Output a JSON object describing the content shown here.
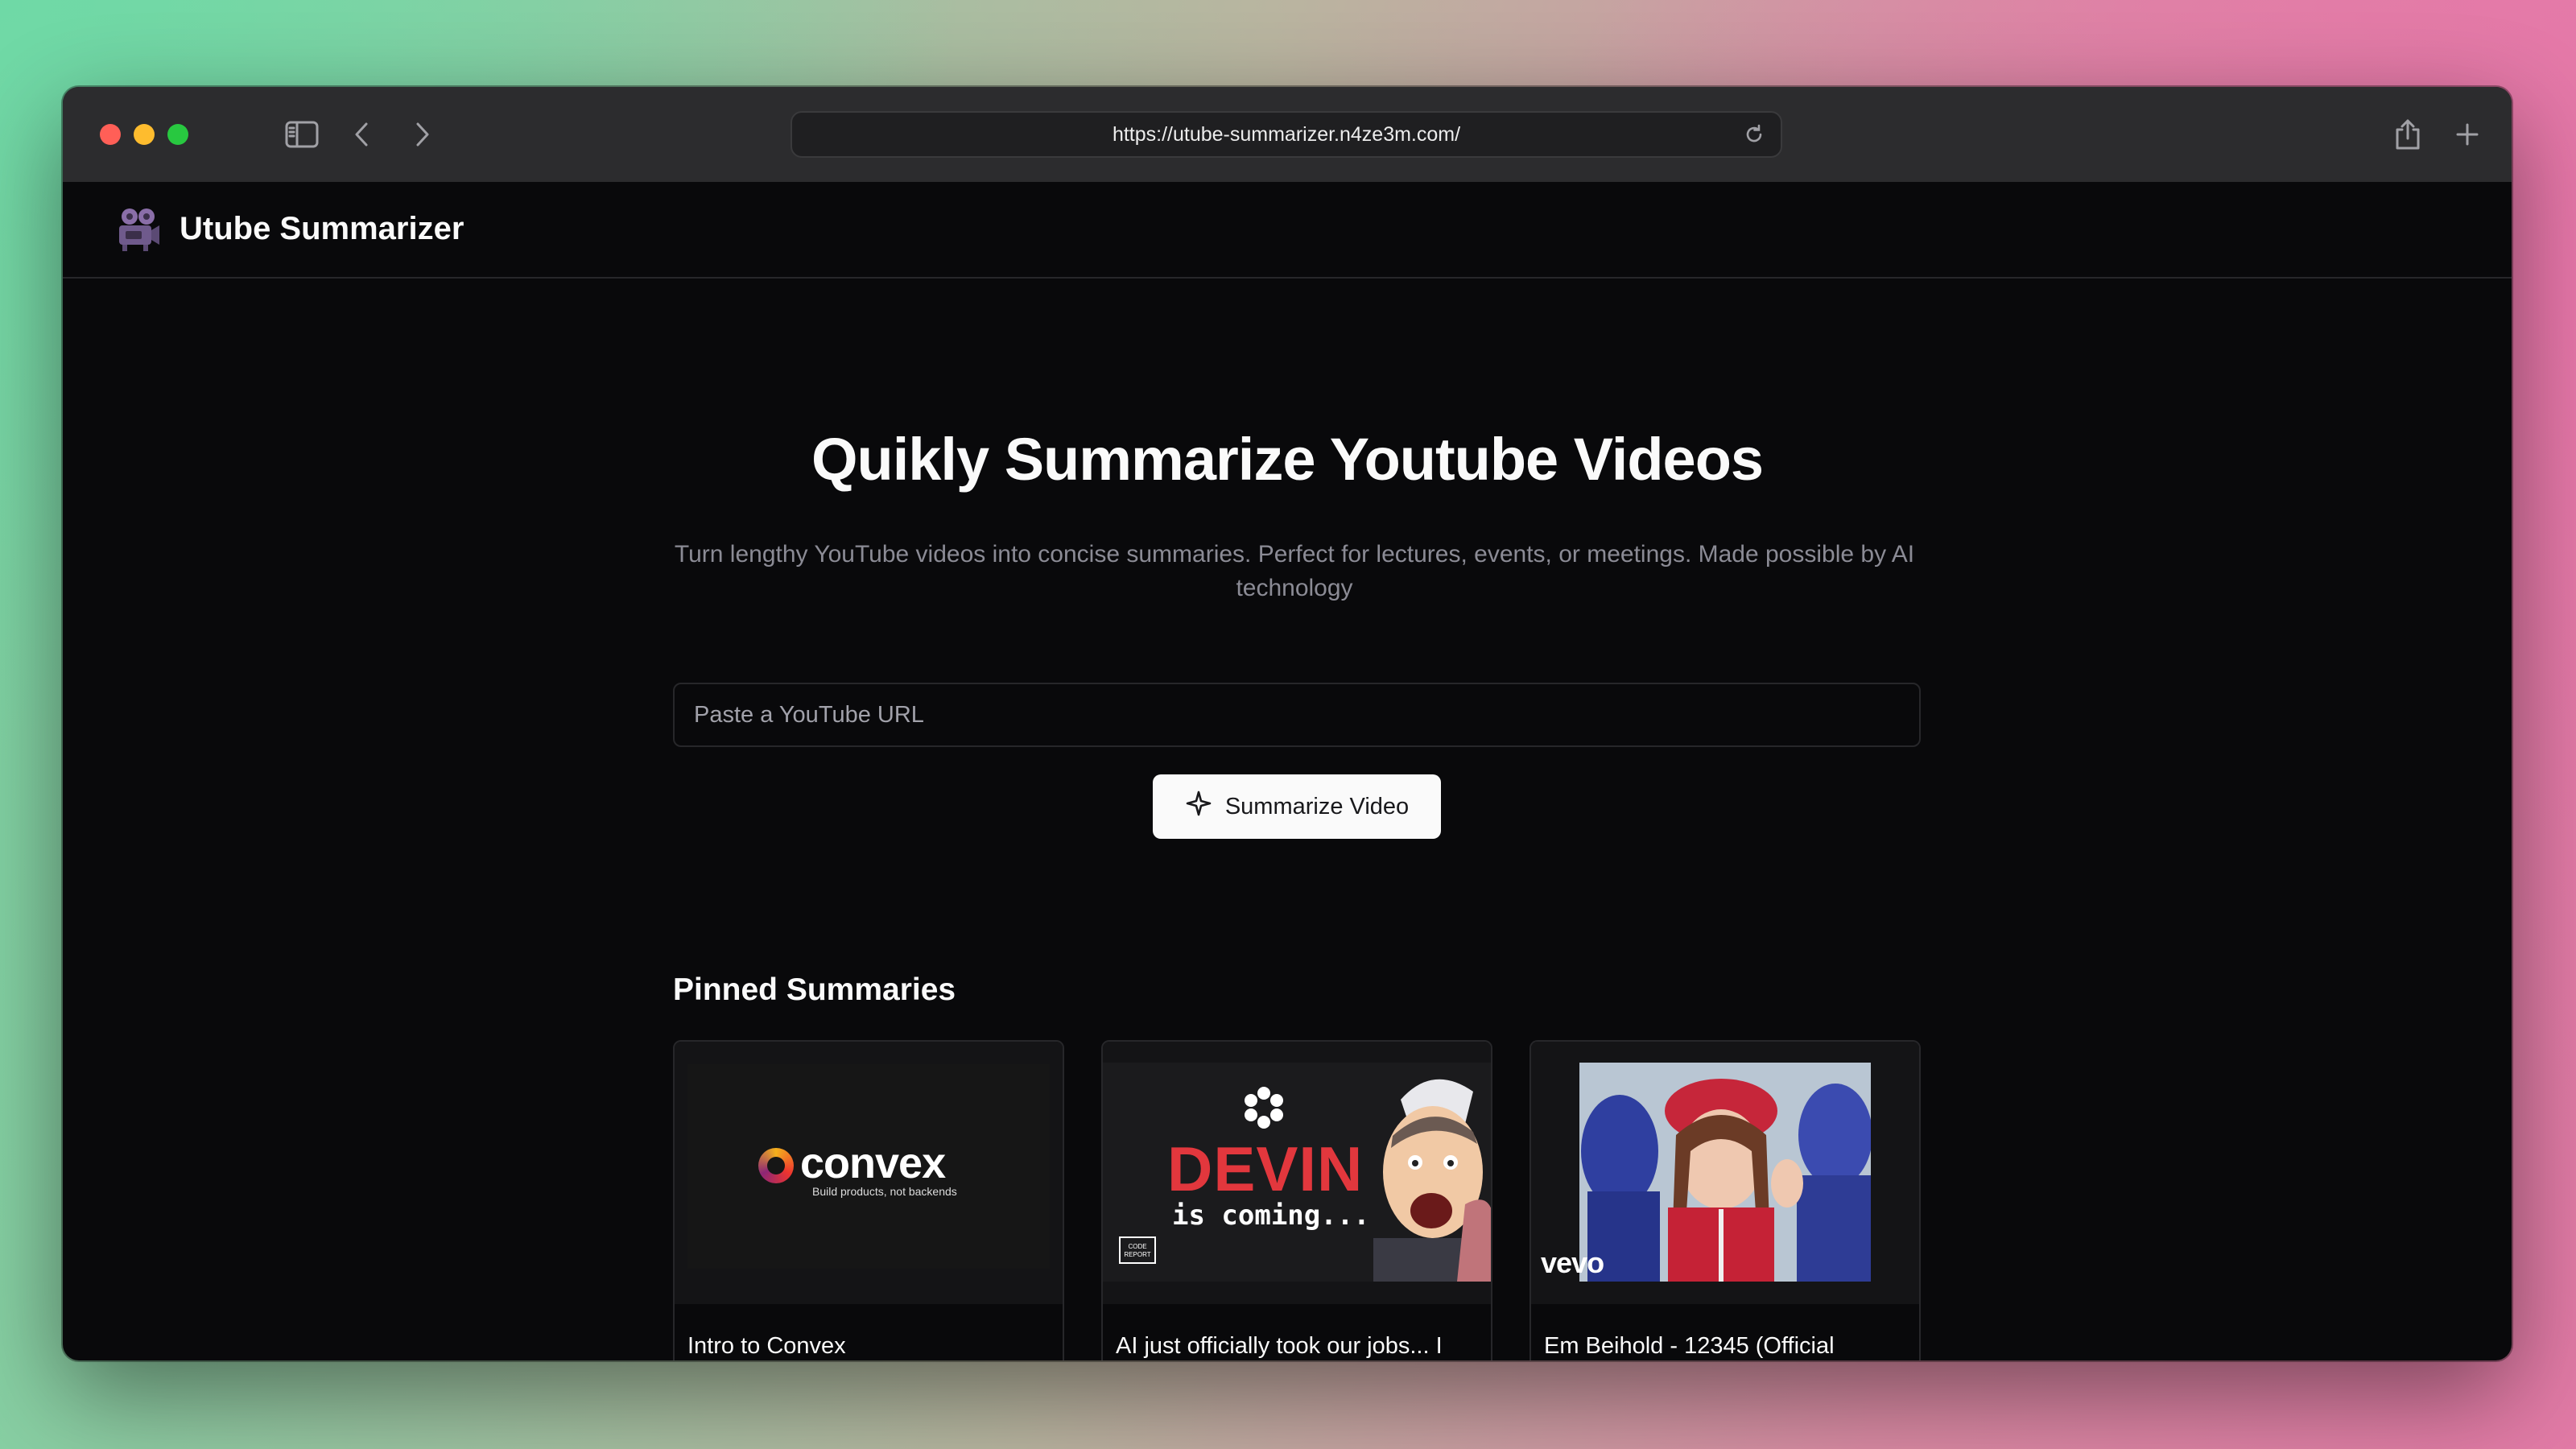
{
  "browser": {
    "url": "https://utube-summarizer.n4ze3m.com/"
  },
  "app": {
    "name": "Utube Summarizer"
  },
  "hero": {
    "title": "Quikly Summarize Youtube Videos",
    "subtitle": "Turn lengthy YouTube videos into concise summaries. Perfect for lectures, events, or meetings. Made possible by AI technology",
    "input_placeholder": "Paste a YouTube URL",
    "input_value": "",
    "button_label": "Summarize Video"
  },
  "pinned": {
    "heading": "Pinned Summaries",
    "cards": [
      {
        "title": "Intro to Convex",
        "thumb_brand": "convex",
        "thumb_tagline": "Build products, not backends"
      },
      {
        "title": "AI just officially took our jobs... I",
        "thumb_headline": "DEVIN",
        "thumb_subline": "is coming...",
        "thumb_badge": "CODE REPORT"
      },
      {
        "title": "Em Beihold - 12345 (Official",
        "thumb_watermark": "vevo"
      }
    ]
  },
  "colors": {
    "background": "#09090b",
    "border": "#27272a",
    "text": "#fafafa",
    "muted": "#8b8b95",
    "button_bg": "#fafafa"
  },
  "icons": {
    "logo": "movie-camera-icon",
    "button": "sparkle-icon"
  }
}
